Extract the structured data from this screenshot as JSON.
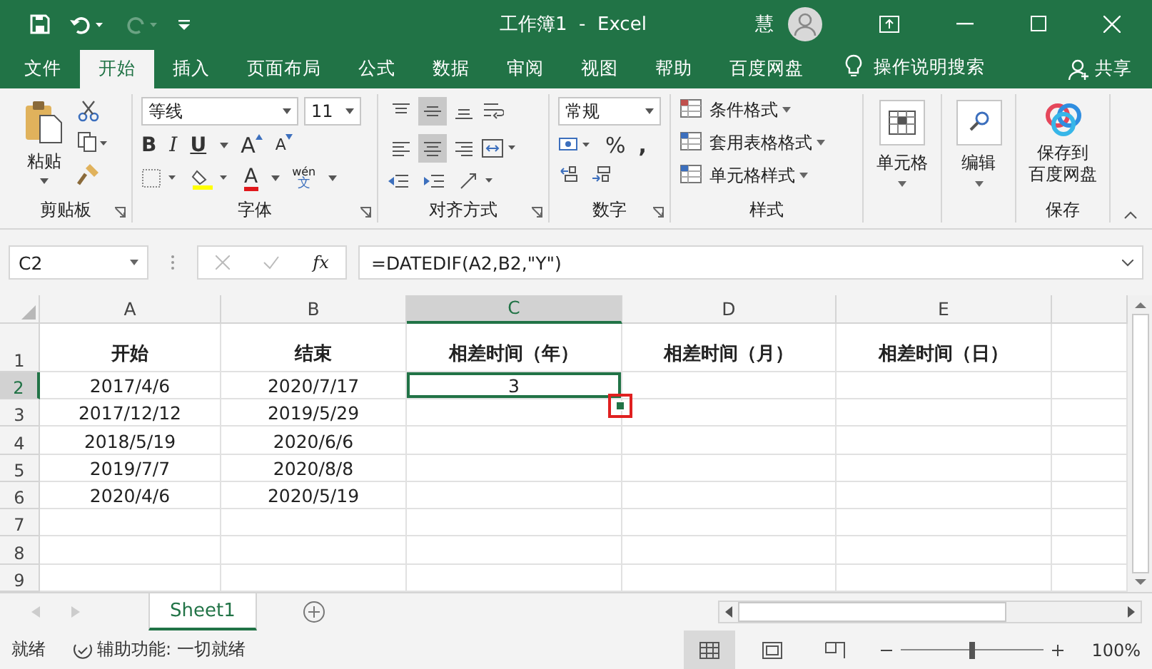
{
  "window": {
    "title": "工作簿1  -  Excel",
    "user": "慧"
  },
  "tabs": [
    {
      "label": "文件",
      "selected": false
    },
    {
      "label": "开始",
      "selected": true
    },
    {
      "label": "插入",
      "selected": false
    },
    {
      "label": "页面布局",
      "selected": false
    },
    {
      "label": "公式",
      "selected": false
    },
    {
      "label": "数据",
      "selected": false
    },
    {
      "label": "审阅",
      "selected": false
    },
    {
      "label": "视图",
      "selected": false
    },
    {
      "label": "帮助",
      "selected": false
    },
    {
      "label": "百度网盘",
      "selected": false
    }
  ],
  "tell_me": "操作说明搜索",
  "share": "共享",
  "ribbon": {
    "clipboard": {
      "paste": "粘贴",
      "label": "剪贴板"
    },
    "font": {
      "name": "等线",
      "size": "11",
      "bold": "B",
      "italic": "I",
      "underline": "U",
      "grow": "A",
      "shrink": "A",
      "font_color_glyph": "A",
      "phonetic_top": "wén",
      "phonetic_bottom": "文",
      "label": "字体"
    },
    "alignment": {
      "vertical": [
        {
          "kind": "top",
          "selected": false
        },
        {
          "kind": "middle",
          "selected": true
        },
        {
          "kind": "bottom",
          "selected": false
        }
      ],
      "horizontal": [
        {
          "kind": "left",
          "selected": false
        },
        {
          "kind": "center",
          "selected": true
        },
        {
          "kind": "right",
          "selected": false
        }
      ],
      "label": "对齐方式"
    },
    "number": {
      "format": "常规",
      "percent": "%",
      "comma": ",",
      "label": "数字"
    },
    "styles": {
      "items": [
        "条件格式",
        "套用表格格式",
        "单元格样式"
      ],
      "label": "样式"
    },
    "cells": {
      "button": "单元格"
    },
    "editing": {
      "button": "编辑"
    },
    "save": {
      "button_lines": [
        "保存到",
        "百度网盘"
      ],
      "label": "保存"
    }
  },
  "formula_bar": {
    "name_box": "C2",
    "fx": "fx",
    "formula": "=DATEDIF(A2,B2,\"Y\")"
  },
  "columns": [
    {
      "label": "A",
      "selected": false
    },
    {
      "label": "B",
      "selected": false
    },
    {
      "label": "C",
      "selected": true
    },
    {
      "label": "D",
      "selected": false
    },
    {
      "label": "E",
      "selected": false
    }
  ],
  "rows": [
    {
      "number": "1",
      "selected": false,
      "cells": [
        {
          "text": "开始",
          "kind": "header",
          "selected": false
        },
        {
          "text": "结束",
          "kind": "header",
          "selected": false
        },
        {
          "text": "相差时间（年）",
          "kind": "header",
          "selected": false
        },
        {
          "text": "相差时间（月）",
          "kind": "header",
          "selected": false
        },
        {
          "text": "相差时间（日）",
          "kind": "header",
          "selected": false
        }
      ]
    },
    {
      "number": "2",
      "selected": true,
      "cells": [
        {
          "text": "2017/4/6",
          "selected": false
        },
        {
          "text": "2020/7/17",
          "selected": false
        },
        {
          "text": "3",
          "selected": true,
          "handle_marked": true
        }
      ]
    },
    {
      "number": "3",
      "selected": false,
      "cells": [
        {
          "text": "2017/12/12",
          "selected": false
        },
        {
          "text": "2019/5/29",
          "selected": false
        }
      ]
    },
    {
      "number": "4",
      "selected": false,
      "cells": [
        {
          "text": "2018/5/19",
          "selected": false
        },
        {
          "text": "2020/6/6",
          "selected": false
        }
      ]
    },
    {
      "number": "5",
      "selected": false,
      "cells": [
        {
          "text": "2019/7/7",
          "selected": false
        },
        {
          "text": "2020/8/8",
          "selected": false
        }
      ]
    },
    {
      "number": "6",
      "selected": false,
      "cells": [
        {
          "text": "2020/4/6",
          "selected": false
        },
        {
          "text": "2020/5/19",
          "selected": false
        }
      ]
    },
    {
      "number": "7",
      "selected": false,
      "cells": []
    },
    {
      "number": "8",
      "selected": false,
      "cells": []
    },
    {
      "number": "9",
      "selected": false,
      "cells": []
    }
  ],
  "sheets": [
    {
      "label": "Sheet1",
      "selected": true
    }
  ],
  "status_bar": {
    "status": "就绪",
    "accessibility": "辅助功能: 一切就绪",
    "zoom": "100%",
    "zoom_slider": {
      "level": 0.5
    }
  }
}
